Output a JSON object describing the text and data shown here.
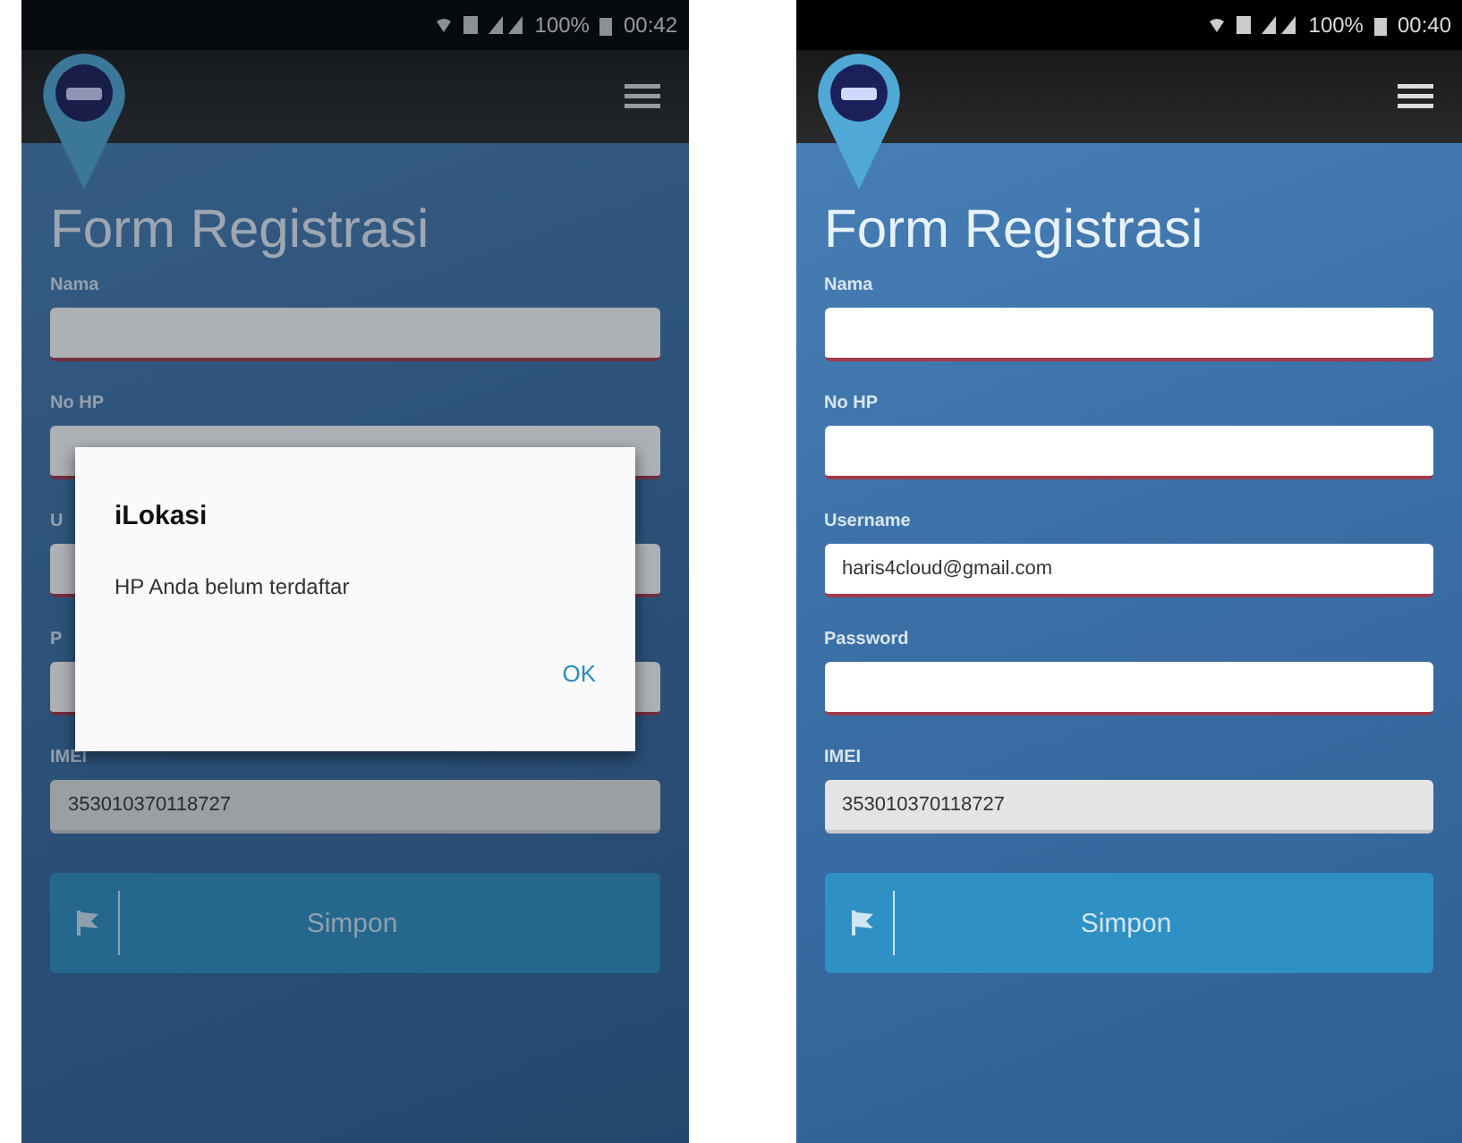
{
  "phones": [
    {
      "status_bar": {
        "battery": "100%",
        "time": "00:42"
      },
      "title": "Form Registrasi",
      "fields": [
        {
          "label": "Nama",
          "disabled": false
        },
        {
          "label": "No HP",
          "disabled": false
        },
        {
          "label": "U",
          "disabled": false
        },
        {
          "label": "P",
          "disabled": false
        },
        {
          "label": "IMEI",
          "value": "353010370118727",
          "disabled": true
        }
      ],
      "submit": "Simpon",
      "dialog": {
        "title": "iLokasi",
        "message": "HP Anda belum terdaftar",
        "button": "OK"
      }
    },
    {
      "status_bar": {
        "battery": "100%",
        "time": "00:40"
      },
      "title": "Form Registrasi",
      "fields": [
        {
          "label": "Nama",
          "disabled": false
        },
        {
          "label": "No HP",
          "disabled": false
        },
        {
          "label": "Username",
          "value": "haris4cloud@gmail.com",
          "disabled": false
        },
        {
          "label": "Password",
          "disabled": false
        },
        {
          "label": "IMEI",
          "value": "353010370118727",
          "disabled": true
        }
      ],
      "submit": "Simpon"
    }
  ]
}
